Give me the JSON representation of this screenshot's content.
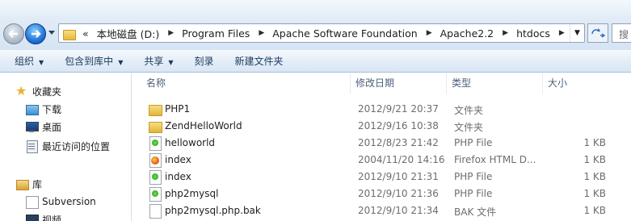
{
  "address": {
    "crumbs": [
      "本地磁盘 (D:)",
      "Program Files",
      "Apache Software Foundation",
      "Apache2.2",
      "htdocs"
    ],
    "overflow_marker": "«",
    "search_placeholder": "搜"
  },
  "toolbar": {
    "organize": "组织",
    "include_library": "包含到库中",
    "share": "共享",
    "burn": "刻录",
    "new_folder": "新建文件夹"
  },
  "nav": {
    "favorites": "收藏夹",
    "downloads": "下载",
    "desktop": "桌面",
    "recent_places": "最近访问的位置",
    "libraries": "库",
    "subversion": "Subversion",
    "video": "视频"
  },
  "columns": {
    "name": "名称",
    "date": "修改日期",
    "type": "类型",
    "size": "大小"
  },
  "files": [
    {
      "name": "PHP1",
      "date": "2012/9/21 20:37",
      "type": "文件夹",
      "size": "",
      "icon": "folder-icon"
    },
    {
      "name": "ZendHelloWorld",
      "date": "2012/9/16 10:38",
      "type": "文件夹",
      "size": "",
      "icon": "folder-icon"
    },
    {
      "name": "helloworld",
      "date": "2012/8/23 21:42",
      "type": "PHP File",
      "size": "1 KB",
      "icon": "php-file-icon"
    },
    {
      "name": "index",
      "date": "2004/11/20 14:16",
      "type": "Firefox HTML D...",
      "size": "1 KB",
      "icon": "firefox-html-icon"
    },
    {
      "name": "index",
      "date": "2012/9/10 21:31",
      "type": "PHP File",
      "size": "1 KB",
      "icon": "php-file-icon"
    },
    {
      "name": "php2mysql",
      "date": "2012/9/10 21:36",
      "type": "PHP File",
      "size": "1 KB",
      "icon": "php-file-icon"
    },
    {
      "name": "php2mysql.php.bak",
      "date": "2012/9/10 21:34",
      "type": "BAK 文件",
      "size": "1 KB",
      "icon": "bak-file-icon"
    }
  ]
}
